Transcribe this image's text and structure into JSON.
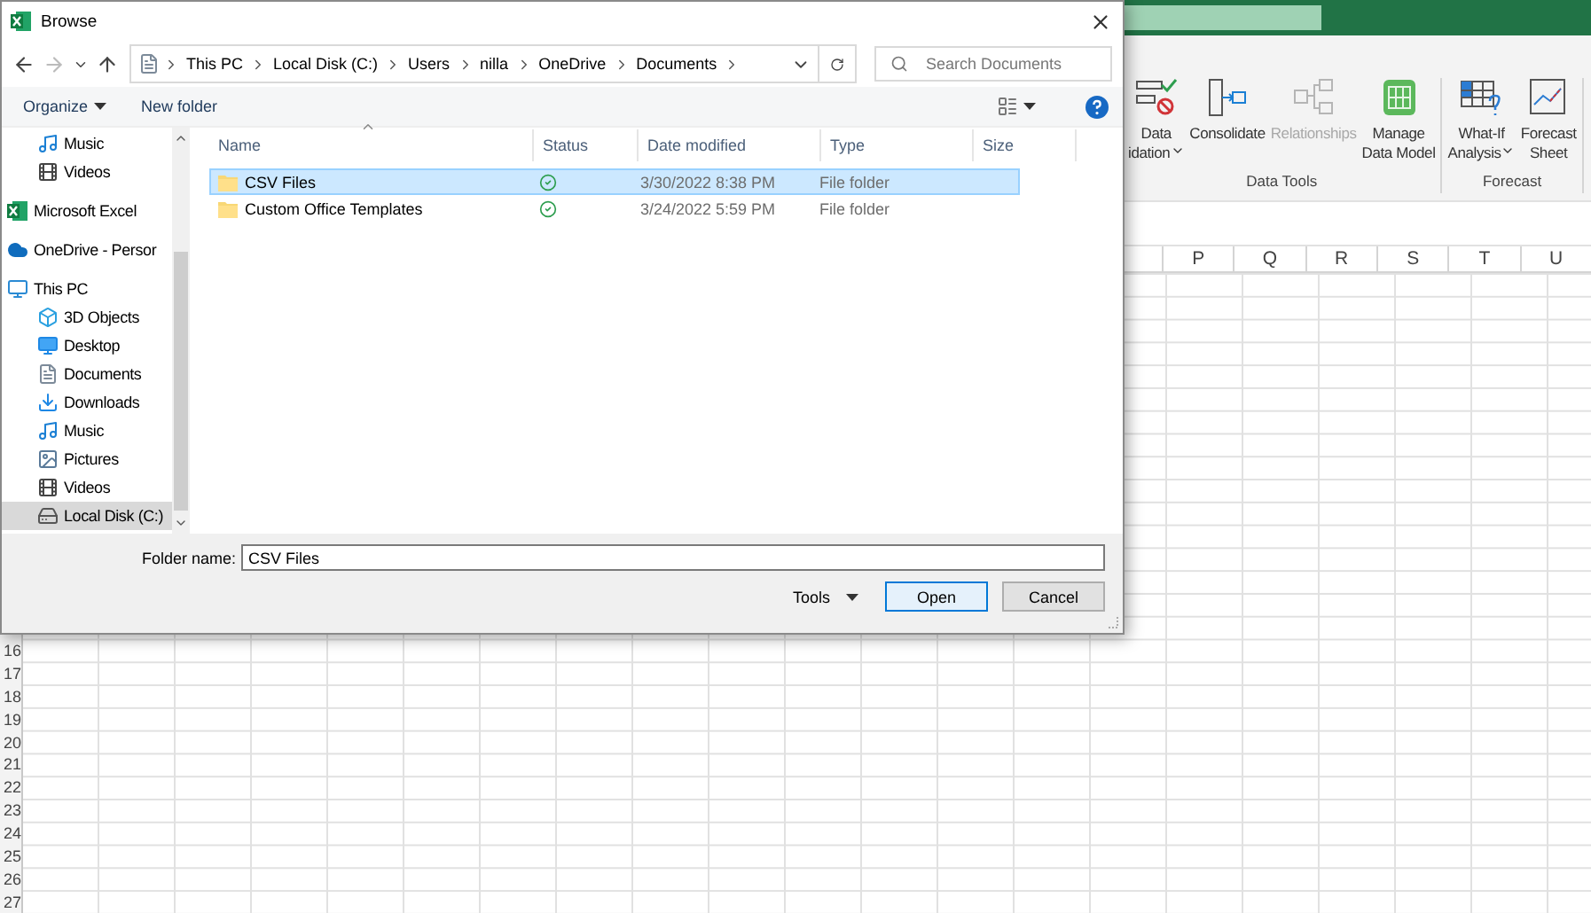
{
  "ribbon": {
    "groups": [
      {
        "label": "Data Tools",
        "buttons": [
          {
            "kind": "validation",
            "lines": [
              "Data",
              "idation"
            ],
            "dropdown": true,
            "disabled": false
          },
          {
            "kind": "consolidate",
            "lines": [
              "Consolidate"
            ],
            "dropdown": false,
            "disabled": false
          },
          {
            "kind": "relationships",
            "lines": [
              "Relationships"
            ],
            "dropdown": false,
            "disabled": true
          },
          {
            "kind": "datamodel",
            "lines": [
              "Manage",
              "Data Model"
            ],
            "dropdown": false,
            "disabled": false
          }
        ]
      },
      {
        "label": "Forecast",
        "buttons": [
          {
            "kind": "whatif",
            "lines": [
              "What-If",
              "Analysis"
            ],
            "dropdown": true,
            "disabled": false
          },
          {
            "kind": "forecast",
            "lines": [
              "Forecast",
              "Sheet"
            ],
            "dropdown": false,
            "disabled": false
          }
        ]
      }
    ]
  },
  "sheet": {
    "columns": [
      "P",
      "Q",
      "R",
      "S",
      "T",
      "U"
    ],
    "rows": [
      "16",
      "17",
      "18",
      "19",
      "20",
      "21",
      "22",
      "23",
      "24",
      "25",
      "26",
      "27"
    ]
  },
  "dialog": {
    "title": "Browse",
    "breadcrumb": [
      "This PC",
      "Local Disk (C:)",
      "Users",
      "nilla",
      "OneDrive",
      "Documents"
    ],
    "search": {
      "placeholder": "Search Documents"
    },
    "toolbar": {
      "organize": "Organize",
      "new_folder": "New folder"
    },
    "sidebar": [
      {
        "kind": "group",
        "children": [
          {
            "kind": "music",
            "label": "Music",
            "selected": false
          },
          {
            "kind": "videos",
            "label": "Videos",
            "selected": false
          }
        ]
      },
      {
        "kind": "excel",
        "label": "Microsoft Excel",
        "selected": false
      },
      {
        "kind": "onedrive",
        "label": "OneDrive - Persor",
        "selected": false
      },
      {
        "kind": "pc",
        "label": "This PC",
        "selected": false,
        "children": [
          {
            "kind": "objects3d",
            "label": "3D Objects",
            "selected": false
          },
          {
            "kind": "desktop",
            "label": "Desktop",
            "selected": false
          },
          {
            "kind": "documents",
            "label": "Documents",
            "selected": false
          },
          {
            "kind": "downloads",
            "label": "Downloads",
            "selected": false
          },
          {
            "kind": "music",
            "label": "Music",
            "selected": false
          },
          {
            "kind": "pictures",
            "label": "Pictures",
            "selected": false
          },
          {
            "kind": "videos",
            "label": "Videos",
            "selected": false
          },
          {
            "kind": "disk",
            "label": "Local Disk (C:)",
            "selected": true
          }
        ]
      }
    ],
    "columns": [
      "Name",
      "Status",
      "Date modified",
      "Type",
      "Size"
    ],
    "rows": [
      {
        "name": "CSV Files",
        "synced": true,
        "date": "3/30/2022 8:38 PM",
        "type": "File folder",
        "selected": true
      },
      {
        "name": "Custom Office Templates",
        "synced": true,
        "date": "3/24/2022 5:59 PM",
        "type": "File folder",
        "selected": false
      }
    ],
    "folder_name": {
      "label": "Folder name:",
      "value": "CSV Files"
    },
    "buttons": {
      "tools": "Tools",
      "open": "Open",
      "cancel": "Cancel"
    }
  }
}
